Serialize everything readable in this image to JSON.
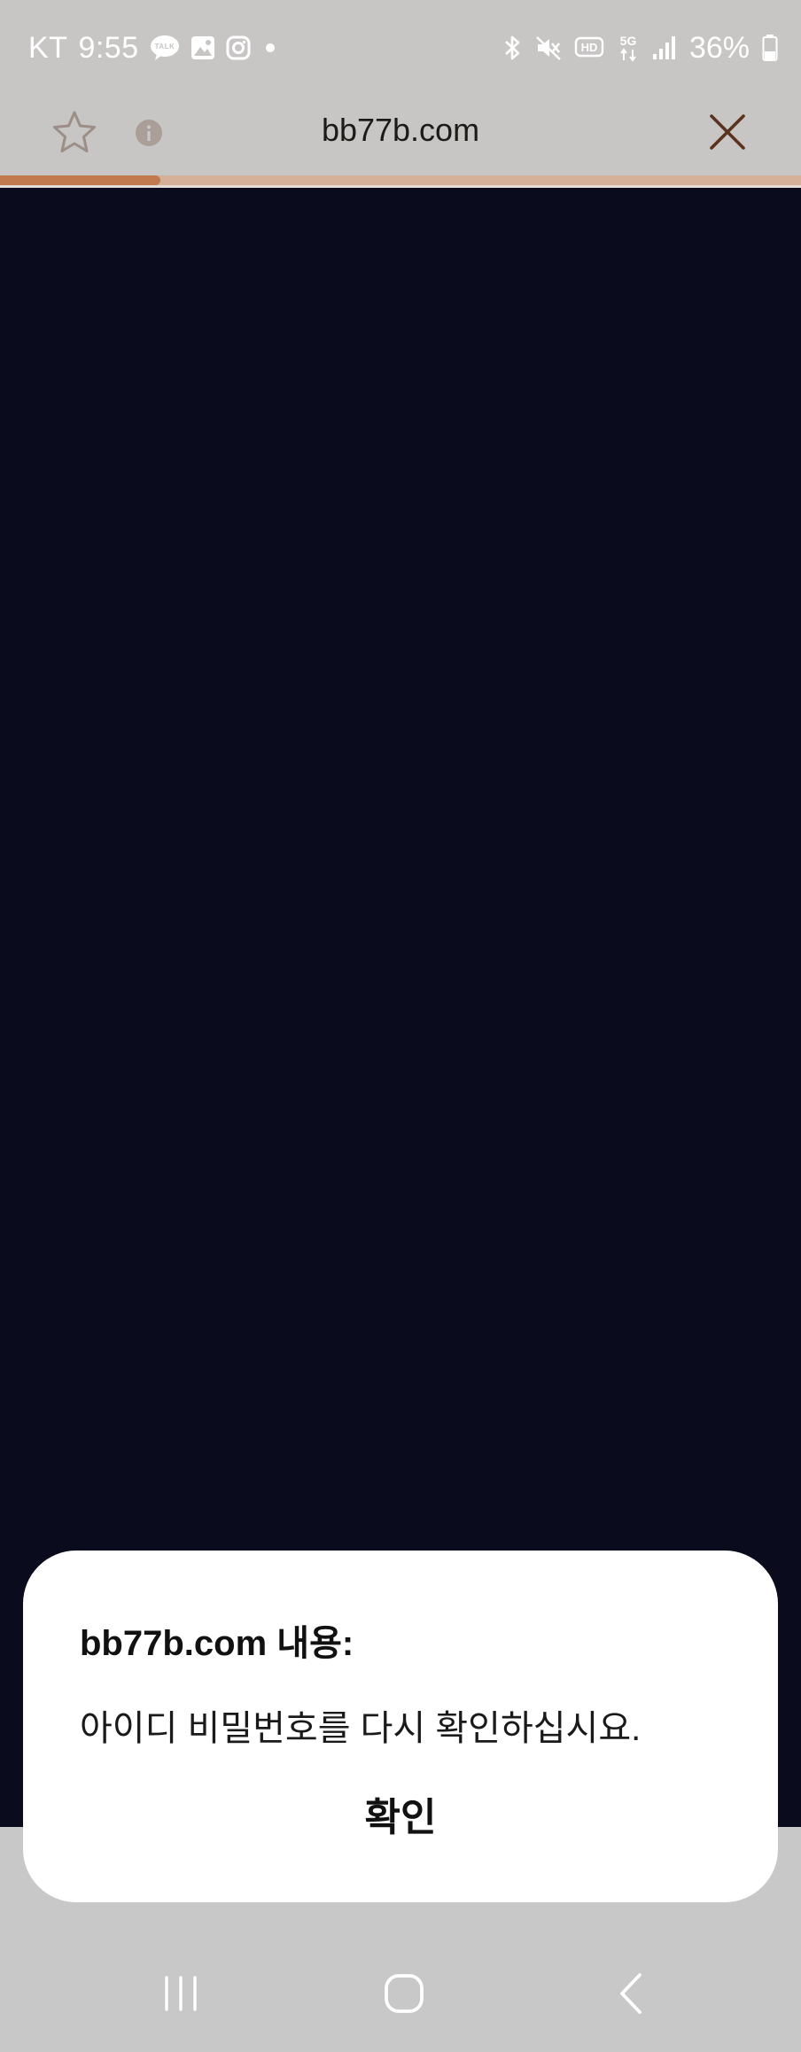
{
  "status_bar": {
    "carrier": "KT",
    "time": "9:55",
    "battery": "36%",
    "left_icons": [
      "kakaotalk-icon",
      "gallery-icon",
      "instagram-icon",
      "dot-icon"
    ],
    "right_icons": [
      "bluetooth-icon",
      "mute-icon",
      "hd-icon",
      "5g-icon",
      "signal-icon",
      "battery-icon"
    ],
    "hd_label": "HD",
    "net_label": "5G",
    "talk_label": "TALK"
  },
  "browser": {
    "url": "bb77b.com",
    "load_progress": 0.2,
    "colors": {
      "toolbar": "#c8c6c5",
      "progress_track": "#d5b199",
      "progress_fill": "#c07a4d",
      "close_icon": "#5a3220",
      "page_background": "#0a0c1d"
    }
  },
  "dialog": {
    "title": "bb77b.com 내용:",
    "message": "아이디 비밀번호를 다시 확인하십시요.",
    "ok_label": "확인"
  },
  "nav_bar": {
    "buttons": [
      "recents-icon",
      "home-icon",
      "back-icon"
    ]
  }
}
